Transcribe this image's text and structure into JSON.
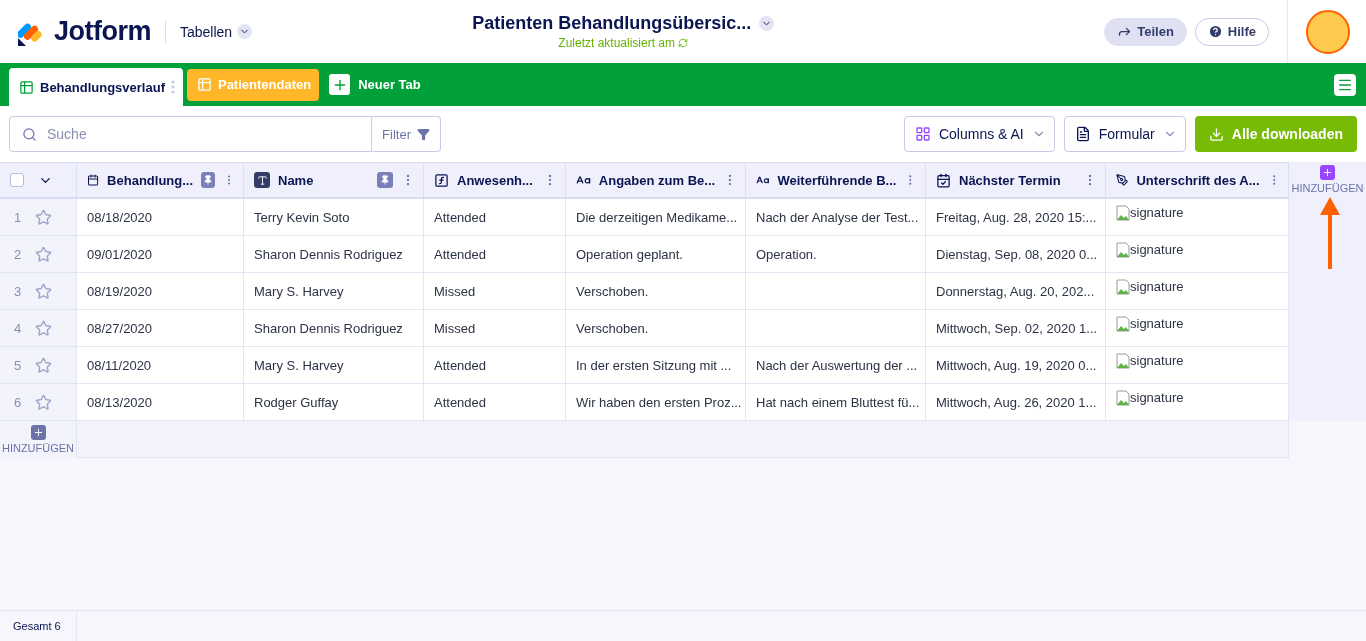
{
  "header": {
    "logo": "Jotform",
    "app_switcher": "Tabellen",
    "title": "Patienten Behandlungsübersic...",
    "subtitle": "Zuletzt aktualisiert am",
    "share": "Teilen",
    "help": "Hilfe"
  },
  "tabs": [
    {
      "label": "Behandlungsverlauf",
      "selected": true
    },
    {
      "label": "Patientendaten",
      "selected": false
    }
  ],
  "new_tab": "Neuer Tab",
  "toolbar": {
    "search": {
      "placeholder": "Suche"
    },
    "filter": "Filter",
    "columns_ai": "Columns & AI",
    "form": "Formular",
    "download": "Alle downloaden"
  },
  "table": {
    "select_all": {
      "checked": false
    },
    "columns": [
      {
        "label": "Behandlung...",
        "kind": "date",
        "pinned": true
      },
      {
        "label": "Name",
        "kind": "text",
        "pinned": true
      },
      {
        "label": "Anwesenh...",
        "kind": "formula",
        "pinned": false
      },
      {
        "label": "Angaben zum Be...",
        "kind": "longtext",
        "pinned": false
      },
      {
        "label": "Weiterführende B...",
        "kind": "longtext",
        "pinned": false
      },
      {
        "label": "Nächster Termin",
        "kind": "datetime",
        "pinned": false
      },
      {
        "label": "Unterschrift des A...",
        "kind": "signature",
        "pinned": false
      }
    ],
    "rows": [
      {
        "number": "1",
        "starred": false,
        "cells": [
          "08/18/2020",
          "Terry Kevin Soto",
          "Attended",
          "Die derzeitigen Medikame...",
          "Nach der Analyse der Test...",
          "Freitag, Aug. 28, 2020 15:...",
          "signature"
        ]
      },
      {
        "number": "2",
        "starred": false,
        "cells": [
          "09/01/2020",
          "Sharon Dennis Rodriguez",
          "Attended",
          "Operation geplant.",
          "Operation.",
          "Dienstag, Sep. 08, 2020 0...",
          "signature"
        ]
      },
      {
        "number": "3",
        "starred": false,
        "cells": [
          "08/19/2020",
          "Mary S. Harvey",
          "Missed",
          "Verschoben.",
          "",
          "Donnerstag, Aug. 20, 202...",
          "signature"
        ]
      },
      {
        "number": "4",
        "starred": false,
        "cells": [
          "08/27/2020",
          "Sharon Dennis Rodriguez",
          "Missed",
          "Verschoben.",
          "",
          "Mittwoch, Sep. 02, 2020 1...",
          "signature"
        ]
      },
      {
        "number": "5",
        "starred": false,
        "cells": [
          "08/11/2020",
          "Mary S. Harvey",
          "Attended",
          "In der ersten Sitzung mit ...",
          "Nach der Auswertung der ...",
          "Mittwoch, Aug. 19, 2020 0...",
          "signature"
        ]
      },
      {
        "number": "6",
        "starred": false,
        "cells": [
          "08/13/2020",
          "Rodger Guffay",
          "Attended",
          "Wir haben den ersten Proz...",
          "Hat nach einem Bluttest fü...",
          "Mittwoch, Aug. 26, 2020 1...",
          "signature"
        ]
      }
    ],
    "add_column": "HINZUFÜGEN",
    "add_row": "HINZUFÜGEN"
  },
  "footer": {
    "total": "Gesamt 6"
  }
}
